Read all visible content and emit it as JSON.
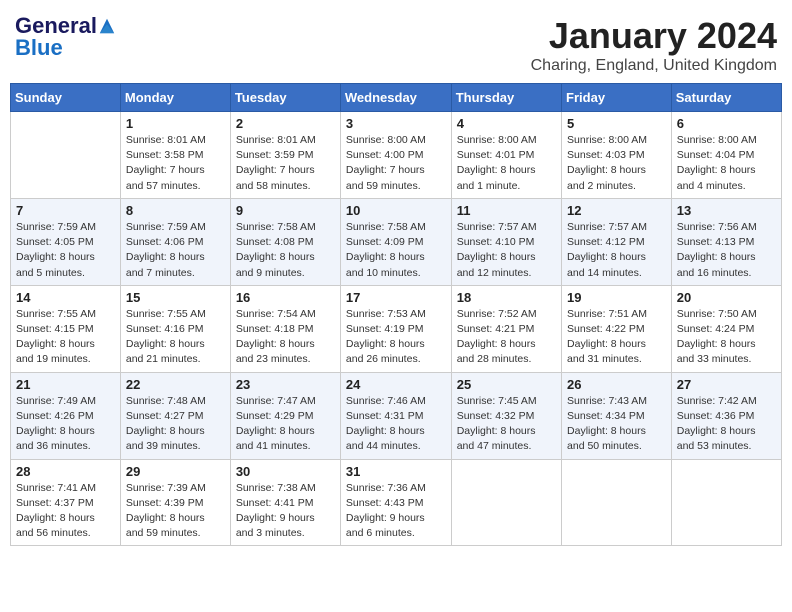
{
  "header": {
    "logo_line1": "General",
    "logo_line2": "Blue",
    "month": "January 2024",
    "location": "Charing, England, United Kingdom"
  },
  "days_of_week": [
    "Sunday",
    "Monday",
    "Tuesday",
    "Wednesday",
    "Thursday",
    "Friday",
    "Saturday"
  ],
  "weeks": [
    [
      {
        "day": "",
        "info": ""
      },
      {
        "day": "1",
        "info": "Sunrise: 8:01 AM\nSunset: 3:58 PM\nDaylight: 7 hours\nand 57 minutes."
      },
      {
        "day": "2",
        "info": "Sunrise: 8:01 AM\nSunset: 3:59 PM\nDaylight: 7 hours\nand 58 minutes."
      },
      {
        "day": "3",
        "info": "Sunrise: 8:00 AM\nSunset: 4:00 PM\nDaylight: 7 hours\nand 59 minutes."
      },
      {
        "day": "4",
        "info": "Sunrise: 8:00 AM\nSunset: 4:01 PM\nDaylight: 8 hours\nand 1 minute."
      },
      {
        "day": "5",
        "info": "Sunrise: 8:00 AM\nSunset: 4:03 PM\nDaylight: 8 hours\nand 2 minutes."
      },
      {
        "day": "6",
        "info": "Sunrise: 8:00 AM\nSunset: 4:04 PM\nDaylight: 8 hours\nand 4 minutes."
      }
    ],
    [
      {
        "day": "7",
        "info": "Sunrise: 7:59 AM\nSunset: 4:05 PM\nDaylight: 8 hours\nand 5 minutes."
      },
      {
        "day": "8",
        "info": "Sunrise: 7:59 AM\nSunset: 4:06 PM\nDaylight: 8 hours\nand 7 minutes."
      },
      {
        "day": "9",
        "info": "Sunrise: 7:58 AM\nSunset: 4:08 PM\nDaylight: 8 hours\nand 9 minutes."
      },
      {
        "day": "10",
        "info": "Sunrise: 7:58 AM\nSunset: 4:09 PM\nDaylight: 8 hours\nand 10 minutes."
      },
      {
        "day": "11",
        "info": "Sunrise: 7:57 AM\nSunset: 4:10 PM\nDaylight: 8 hours\nand 12 minutes."
      },
      {
        "day": "12",
        "info": "Sunrise: 7:57 AM\nSunset: 4:12 PM\nDaylight: 8 hours\nand 14 minutes."
      },
      {
        "day": "13",
        "info": "Sunrise: 7:56 AM\nSunset: 4:13 PM\nDaylight: 8 hours\nand 16 minutes."
      }
    ],
    [
      {
        "day": "14",
        "info": "Sunrise: 7:55 AM\nSunset: 4:15 PM\nDaylight: 8 hours\nand 19 minutes."
      },
      {
        "day": "15",
        "info": "Sunrise: 7:55 AM\nSunset: 4:16 PM\nDaylight: 8 hours\nand 21 minutes."
      },
      {
        "day": "16",
        "info": "Sunrise: 7:54 AM\nSunset: 4:18 PM\nDaylight: 8 hours\nand 23 minutes."
      },
      {
        "day": "17",
        "info": "Sunrise: 7:53 AM\nSunset: 4:19 PM\nDaylight: 8 hours\nand 26 minutes."
      },
      {
        "day": "18",
        "info": "Sunrise: 7:52 AM\nSunset: 4:21 PM\nDaylight: 8 hours\nand 28 minutes."
      },
      {
        "day": "19",
        "info": "Sunrise: 7:51 AM\nSunset: 4:22 PM\nDaylight: 8 hours\nand 31 minutes."
      },
      {
        "day": "20",
        "info": "Sunrise: 7:50 AM\nSunset: 4:24 PM\nDaylight: 8 hours\nand 33 minutes."
      }
    ],
    [
      {
        "day": "21",
        "info": "Sunrise: 7:49 AM\nSunset: 4:26 PM\nDaylight: 8 hours\nand 36 minutes."
      },
      {
        "day": "22",
        "info": "Sunrise: 7:48 AM\nSunset: 4:27 PM\nDaylight: 8 hours\nand 39 minutes."
      },
      {
        "day": "23",
        "info": "Sunrise: 7:47 AM\nSunset: 4:29 PM\nDaylight: 8 hours\nand 41 minutes."
      },
      {
        "day": "24",
        "info": "Sunrise: 7:46 AM\nSunset: 4:31 PM\nDaylight: 8 hours\nand 44 minutes."
      },
      {
        "day": "25",
        "info": "Sunrise: 7:45 AM\nSunset: 4:32 PM\nDaylight: 8 hours\nand 47 minutes."
      },
      {
        "day": "26",
        "info": "Sunrise: 7:43 AM\nSunset: 4:34 PM\nDaylight: 8 hours\nand 50 minutes."
      },
      {
        "day": "27",
        "info": "Sunrise: 7:42 AM\nSunset: 4:36 PM\nDaylight: 8 hours\nand 53 minutes."
      }
    ],
    [
      {
        "day": "28",
        "info": "Sunrise: 7:41 AM\nSunset: 4:37 PM\nDaylight: 8 hours\nand 56 minutes."
      },
      {
        "day": "29",
        "info": "Sunrise: 7:39 AM\nSunset: 4:39 PM\nDaylight: 8 hours\nand 59 minutes."
      },
      {
        "day": "30",
        "info": "Sunrise: 7:38 AM\nSunset: 4:41 PM\nDaylight: 9 hours\nand 3 minutes."
      },
      {
        "day": "31",
        "info": "Sunrise: 7:36 AM\nSunset: 4:43 PM\nDaylight: 9 hours\nand 6 minutes."
      },
      {
        "day": "",
        "info": ""
      },
      {
        "day": "",
        "info": ""
      },
      {
        "day": "",
        "info": ""
      }
    ]
  ]
}
